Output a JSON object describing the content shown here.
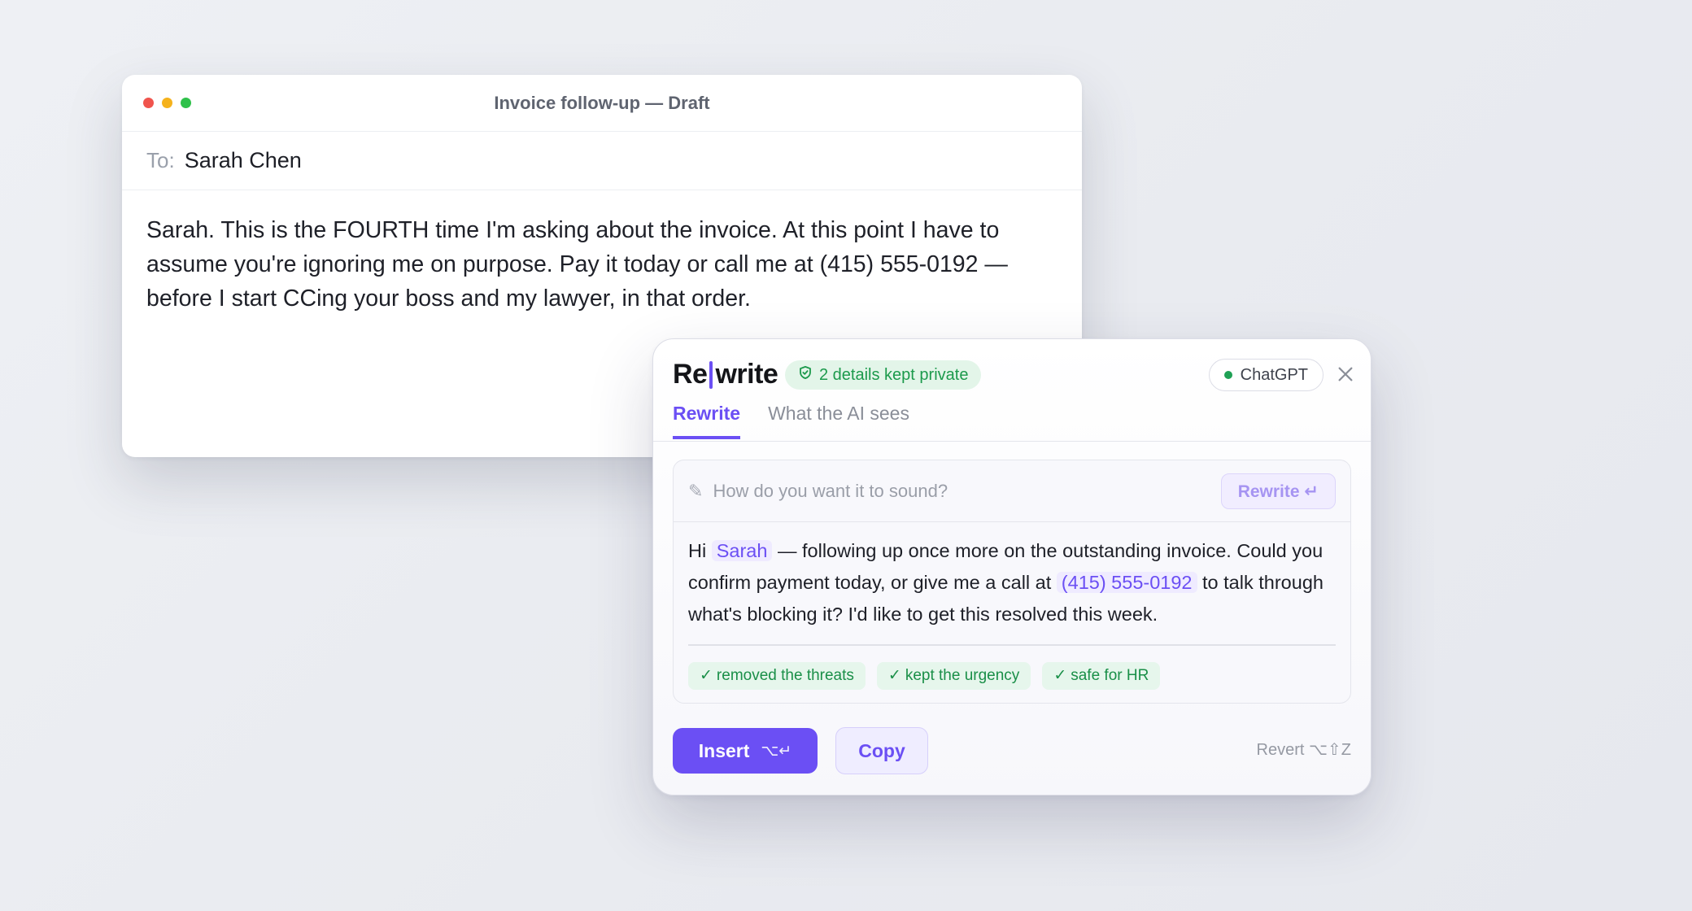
{
  "email": {
    "window_title": "Invoice follow-up — Draft",
    "to_label": "To:",
    "to_value": "Sarah Chen",
    "body": "Sarah. This is the FOURTH time I'm asking about the invoice. At this point I have to assume you're ignoring me on purpose. Pay it today or call me at (415) 555-0192 — before I start CCing your boss and my lawyer, in that order."
  },
  "panel": {
    "logo_left": "Re",
    "logo_right": "write",
    "privacy_badge": "2 details kept private",
    "model": "ChatGPT",
    "tabs": [
      {
        "label": "Rewrite",
        "active": true
      },
      {
        "label": "What the AI sees",
        "active": false
      }
    ],
    "prompt_placeholder": "How do you want it to sound?",
    "rewrite_button": "Rewrite ↵",
    "result": {
      "part1": "Hi",
      "token_name": "Sarah",
      "part2": " — following up once more on the outstanding invoice. Could you confirm payment today, or give me a call at",
      "token_phone": "(415) 555-0192",
      "part3": " to talk through what's blocking it? I'd like to get this resolved this week."
    },
    "chips": [
      "removed the threats",
      "kept the urgency",
      "safe for HR"
    ],
    "chip_check": "✓",
    "insert_label": "Insert",
    "insert_shortcut": "⌥↵",
    "copy_label": "Copy",
    "revert_label": "Revert ⌥⇧Z"
  },
  "colors": {
    "accent": "#6b4ff4",
    "success": "#1c9a4c",
    "traffic_red": "#f0544d",
    "traffic_yellow": "#f5b21c",
    "traffic_green": "#2fc14a"
  },
  "icons": [
    "shield-check-icon",
    "pencil-icon",
    "close-icon",
    "status-dot-icon"
  ]
}
